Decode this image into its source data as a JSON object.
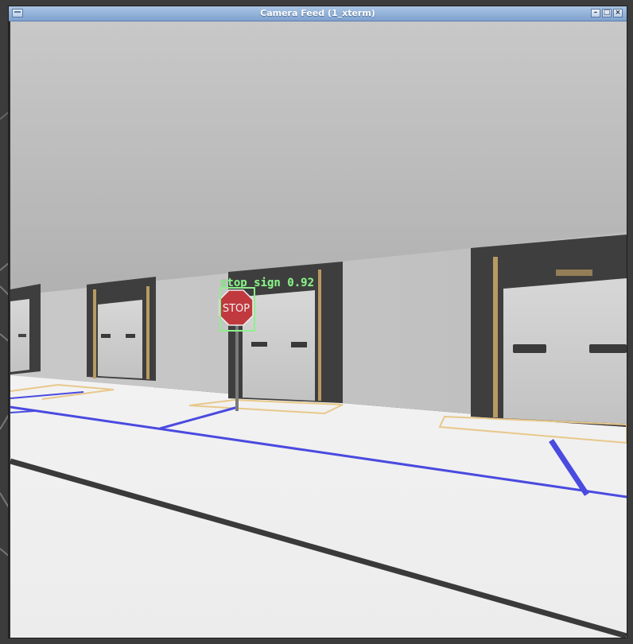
{
  "window": {
    "title": "Camera Feed (1_xterm)",
    "buttons": {
      "minimize": "–",
      "maximize": "□",
      "close": "×"
    }
  },
  "detection": {
    "label": "stop sign 0.92",
    "class": "stop sign",
    "confidence": 0.92
  },
  "scene": {
    "sign_text": "STOP"
  },
  "colors": {
    "titlebar": "#7fa2cf",
    "detection_box": "#8cf08c",
    "floor_line": "#4a4ae0",
    "parking_line": "#e8c88a"
  }
}
